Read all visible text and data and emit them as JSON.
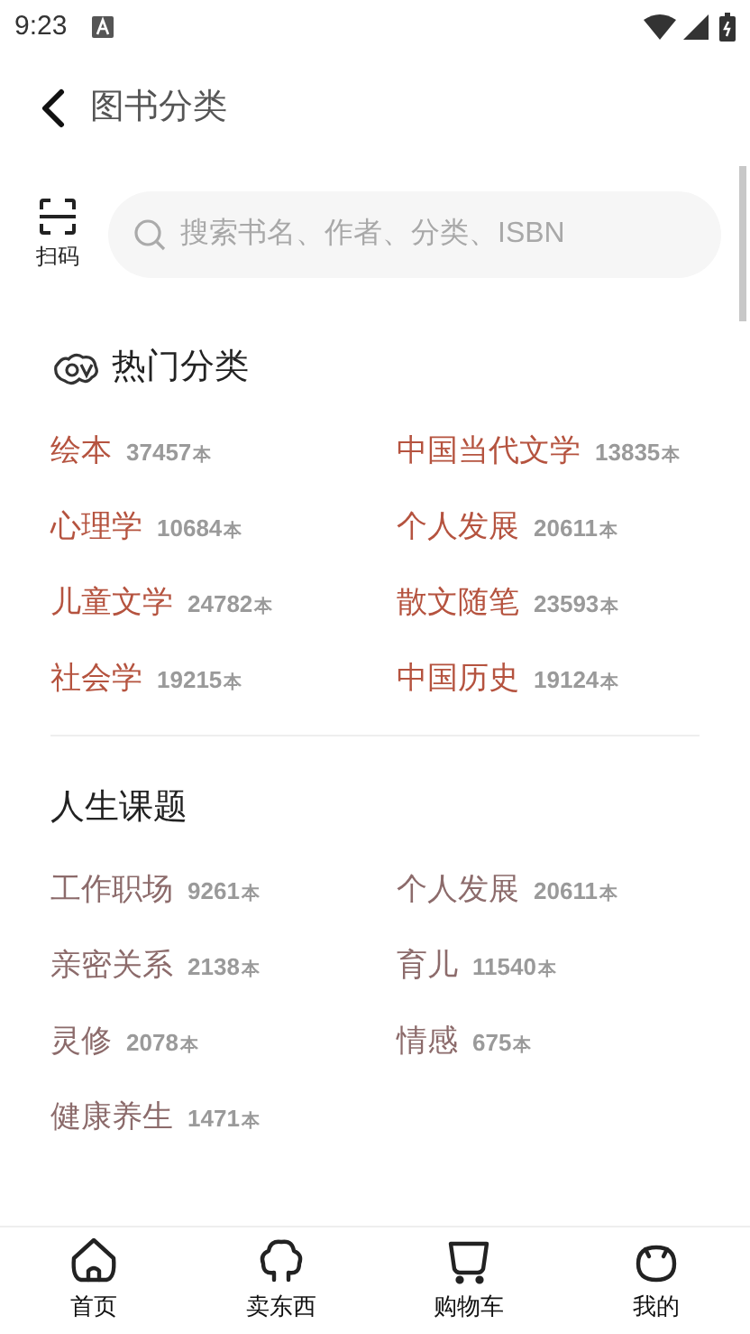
{
  "status_bar": {
    "time": "9:23"
  },
  "header": {
    "title": "图书分类"
  },
  "scan": {
    "label": "扫码"
  },
  "search": {
    "placeholder": "搜索书名、作者、分类、ISBN"
  },
  "sections": [
    {
      "kind": "hot",
      "title": "热门分类",
      "items": [
        {
          "name": "绘本",
          "count": "37457",
          "unit": "本"
        },
        {
          "name": "中国当代文学",
          "count": "13835",
          "unit": "本"
        },
        {
          "name": "心理学",
          "count": "10684",
          "unit": "本"
        },
        {
          "name": "个人发展",
          "count": "20611",
          "unit": "本"
        },
        {
          "name": "儿童文学",
          "count": "24782",
          "unit": "本"
        },
        {
          "name": "散文随笔",
          "count": "23593",
          "unit": "本"
        },
        {
          "name": "社会学",
          "count": "19215",
          "unit": "本"
        },
        {
          "name": "中国历史",
          "count": "19124",
          "unit": "本"
        }
      ]
    },
    {
      "kind": "topic",
      "title": "人生课题",
      "items": [
        {
          "name": "工作职场",
          "count": "9261",
          "unit": "本"
        },
        {
          "name": "个人发展",
          "count": "20611",
          "unit": "本"
        },
        {
          "name": "亲密关系",
          "count": "2138",
          "unit": "本"
        },
        {
          "name": "育儿",
          "count": "11540",
          "unit": "本"
        },
        {
          "name": "灵修",
          "count": "2078",
          "unit": "本"
        },
        {
          "name": "情感",
          "count": "675",
          "unit": "本"
        },
        {
          "name": "健康养生",
          "count": "1471",
          "unit": "本"
        }
      ]
    }
  ],
  "nav": [
    {
      "kind": "home",
      "label": "首页",
      "selected": false
    },
    {
      "kind": "sell",
      "label": "卖东西",
      "selected": false
    },
    {
      "kind": "cart",
      "label": "购物车",
      "selected": false
    },
    {
      "kind": "me",
      "label": "我的",
      "selected": false
    }
  ]
}
